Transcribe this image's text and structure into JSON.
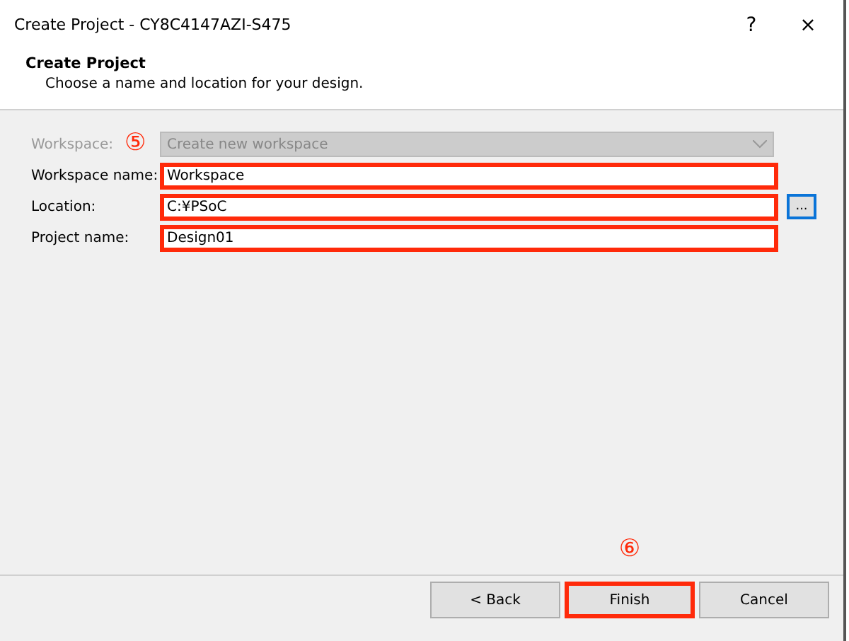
{
  "window": {
    "title": "Create Project - CY8C4147AZI-S475",
    "help": "?",
    "close": "×"
  },
  "header": {
    "title": "Create Project",
    "subtitle": "Choose a name and location for your design."
  },
  "form": {
    "workspace": {
      "label": "Workspace:",
      "value": "Create new workspace",
      "disabled": true,
      "marker": "⑤"
    },
    "fields": [
      {
        "label": "Workspace name:",
        "value": "Workspace",
        "highlighted": true
      },
      {
        "label": "Location:",
        "value": "C:¥PSoC",
        "highlighted": true,
        "browse": "..."
      },
      {
        "label": "Project name:",
        "value": "Design01",
        "highlighted": true
      }
    ]
  },
  "buttons": [
    {
      "label": "< Back",
      "highlighted": false
    },
    {
      "label": "Finish",
      "highlighted": true,
      "marker": "⑥"
    },
    {
      "label": "Cancel",
      "highlighted": false
    }
  ]
}
